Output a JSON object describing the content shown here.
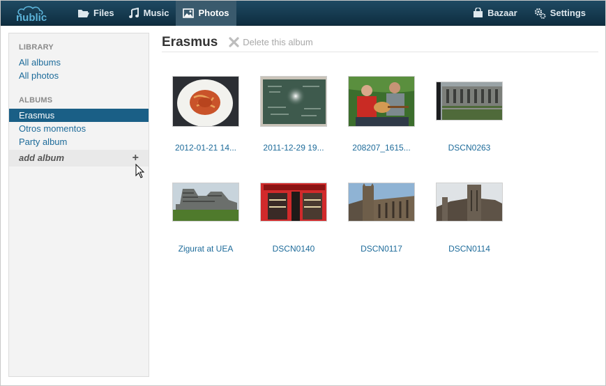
{
  "app": {
    "logo_text": "nublic",
    "nav": [
      {
        "label": "Files",
        "icon": "folder-icon"
      },
      {
        "label": "Music",
        "icon": "music-note-icon"
      },
      {
        "label": "Photos",
        "icon": "picture-icon"
      }
    ],
    "nav_right": [
      {
        "label": "Bazaar",
        "icon": "shopping-bag-icon"
      },
      {
        "label": "Settings",
        "icon": "gears-icon"
      }
    ],
    "active_nav": "Photos"
  },
  "sidebar": {
    "library_heading": "LIBRARY",
    "library_items": [
      "All albums",
      "All photos"
    ],
    "albums_heading": "ALBUMS",
    "album_items": [
      "Erasmus",
      "Otros momentos",
      "Party album"
    ],
    "selected_album": "Erasmus",
    "add_album_label": "add album",
    "add_album_icon": "+"
  },
  "main": {
    "album_title": "Erasmus",
    "delete_label": "Delete this album",
    "photos": [
      {
        "caption": "2012-01-21 14...",
        "scene": "pasta-plate"
      },
      {
        "caption": "2011-12-29 19...",
        "scene": "chalkboard"
      },
      {
        "caption": "208207_1615...",
        "scene": "guitar-players"
      },
      {
        "caption": "DSCN0263",
        "scene": "cloister"
      },
      {
        "caption": "Zigurat at UEA",
        "scene": "zigurat-building"
      },
      {
        "caption": "DSCN0140",
        "scene": "red-shopfront"
      },
      {
        "caption": "DSCN0117",
        "scene": "cathedral-tower"
      },
      {
        "caption": "DSCN0114",
        "scene": "cathedral-facade"
      }
    ]
  },
  "colors": {
    "topbar": "#0e2d40",
    "accent": "#1a5f86",
    "link": "#1d6b9a"
  }
}
